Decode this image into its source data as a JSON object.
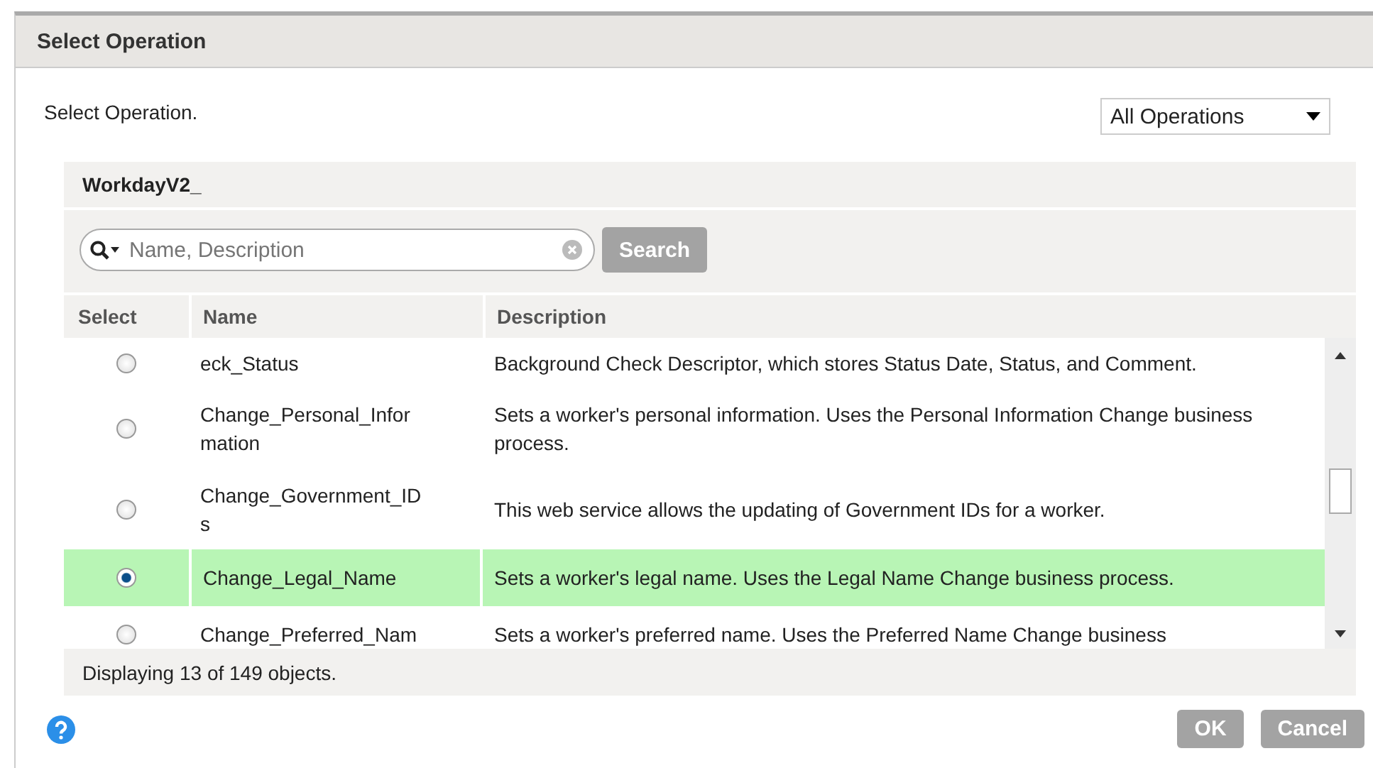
{
  "window": {
    "title": "Select Operation"
  },
  "prompt": "Select Operation.",
  "filter": {
    "value": "All Operations"
  },
  "panel": {
    "title": "WorkdayV2_"
  },
  "search": {
    "placeholder": "Name, Description",
    "button": "Search"
  },
  "table": {
    "columns": [
      "Select",
      "Name",
      "Description"
    ],
    "rows": [
      {
        "name": "eck_Status",
        "description": "Background Check Descriptor, which stores Status Date, Status, and Comment.",
        "selected": false
      },
      {
        "name": "Change_Personal_Infor mation",
        "description": "Sets a worker's personal information. Uses the Personal Information Change business process.",
        "selected": false
      },
      {
        "name": "Change_Government_ID s",
        "description": "This web service allows the updating of Government IDs for a worker.",
        "selected": false
      },
      {
        "name": "Change_Legal_Name",
        "description": "Sets a worker's legal name. Uses the Legal Name Change business process.",
        "selected": true
      },
      {
        "name": "Change_Preferred_Nam",
        "description": "Sets a worker's preferred name. Uses the Preferred Name Change business",
        "selected": false
      }
    ]
  },
  "status": "Displaying 13 of 149 objects.",
  "buttons": [
    {
      "label": "OK"
    },
    {
      "label": "Cancel"
    }
  ]
}
